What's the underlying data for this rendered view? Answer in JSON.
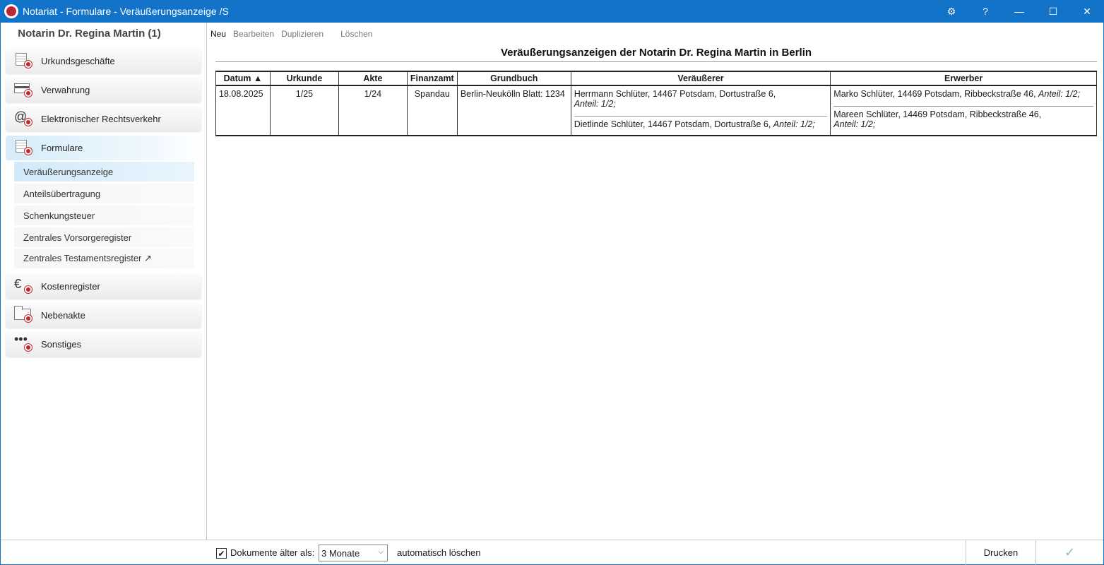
{
  "window": {
    "title": "Notariat - Formulare - Veräußerungsanzeige /S",
    "controls": {
      "settings": "⚙",
      "help": "?",
      "minimize": "—",
      "maximize": "☐",
      "close": "✕"
    }
  },
  "sidebar": {
    "header": "Notarin Dr. Regina Martin (1)",
    "items": [
      {
        "label": "Urkundsgeschäfte",
        "icon": "document-seal-icon"
      },
      {
        "label": "Verwahrung",
        "icon": "card-seal-icon"
      },
      {
        "label": "Elektronischer Rechtsverkehr",
        "icon": "at-seal-icon"
      },
      {
        "label": "Formulare",
        "icon": "document-seal-icon"
      },
      {
        "label": "Kostenregister",
        "icon": "euro-seal-icon"
      },
      {
        "label": "Nebenakte",
        "icon": "folder-seal-icon"
      },
      {
        "label": "Sonstiges",
        "icon": "dots-seal-icon"
      }
    ],
    "subitems": [
      {
        "label": "Veräußerungsanzeige"
      },
      {
        "label": "Anteilsübertragung"
      },
      {
        "label": "Schenkungsteuer"
      },
      {
        "label": "Zentrales Vorsorgeregister"
      },
      {
        "label": "Zentrales Testamentsregister ↗"
      }
    ]
  },
  "toolbar": {
    "new": "Neu",
    "edit": "Bearbeiten",
    "duplicate": "Duplizieren",
    "delete": "Löschen"
  },
  "main": {
    "title": "Veräußerungsanzeigen der Notarin Dr. Regina Martin in Berlin",
    "columns": [
      "Datum ▲",
      "Urkunde",
      "Akte",
      "Finanzamt",
      "Grundbuch",
      "Veräußerer",
      "Erwerber"
    ],
    "rows": [
      {
        "date": "18.08.2025",
        "deed": "1/25",
        "file": "1/24",
        "tax_office": "Spandau",
        "land_register": "Berlin-Neukölln Blatt: 1234",
        "sellers": [
          {
            "text": "Herrmann Schlüter, 14467 Potsdam, Dortustraße 6,",
            "share": "Anteil: 1/2;"
          },
          {
            "text": "Dietlinde Schlüter, 14467 Potsdam, Dortustraße 6,",
            "share": "Anteil: 1/2;"
          }
        ],
        "buyers": [
          {
            "text": "Marko Schlüter, 14469 Potsdam, Ribbeckstraße 46,",
            "share": "Anteil: 1/2;"
          },
          {
            "text": "Mareen Schlüter, 14469 Potsdam, Ribbeckstraße 46,",
            "share": "Anteil: 1/2;"
          }
        ]
      }
    ]
  },
  "footer": {
    "checkbox_label": "Dokumente älter als:",
    "checkbox_checked": true,
    "check_mark": "✔",
    "select_value": "3 Monate",
    "select_arrow": "⌵",
    "auto_delete_label": "automatisch löschen",
    "print_label": "Drucken",
    "ok_label": "✓"
  }
}
